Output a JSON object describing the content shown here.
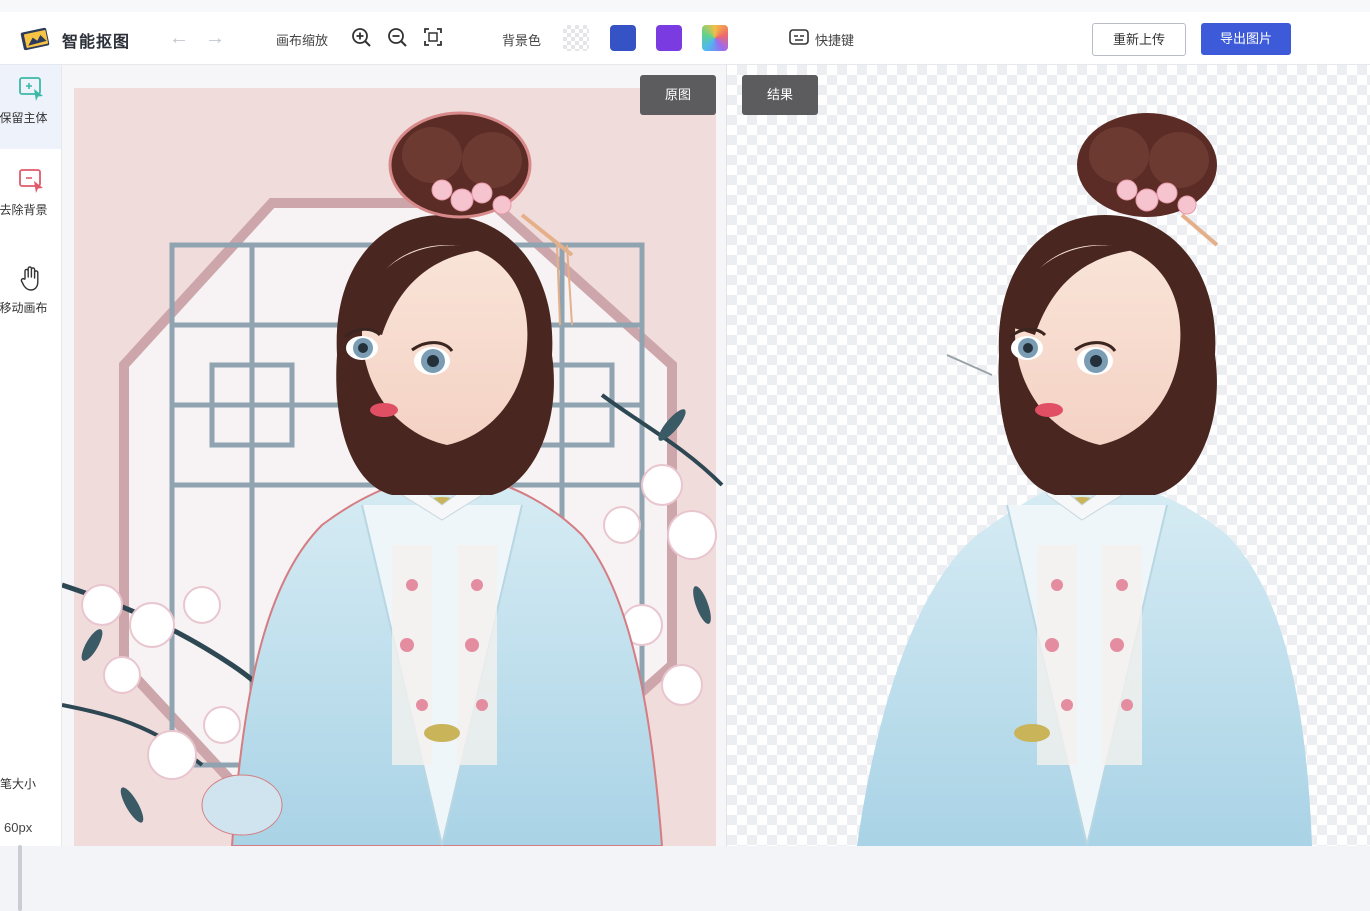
{
  "app": {
    "title": "智能抠图"
  },
  "toolbar": {
    "canvas_zoom_label": "画布缩放",
    "background_color_label": "背景色",
    "shortcut_label": "快捷键",
    "reupload_label": "重新上传",
    "export_label": "导出图片",
    "swatches": [
      {
        "name": "transparent",
        "color": "transparent"
      },
      {
        "name": "blue",
        "color": "#3553c4"
      },
      {
        "name": "purple",
        "color": "#7a3ce0"
      },
      {
        "name": "gradient",
        "color": "multicolor"
      }
    ]
  },
  "sidebar": {
    "items": [
      {
        "label": "保留主体",
        "icon": "select-subject-icon"
      },
      {
        "label": "去除背景",
        "icon": "remove-background-icon"
      },
      {
        "label": "移动画布",
        "icon": "hand-icon"
      }
    ],
    "brush_size_label": "画笔大小",
    "brush_size_value": "60px"
  },
  "panels": {
    "original_label": "原图",
    "result_label": "结果"
  }
}
